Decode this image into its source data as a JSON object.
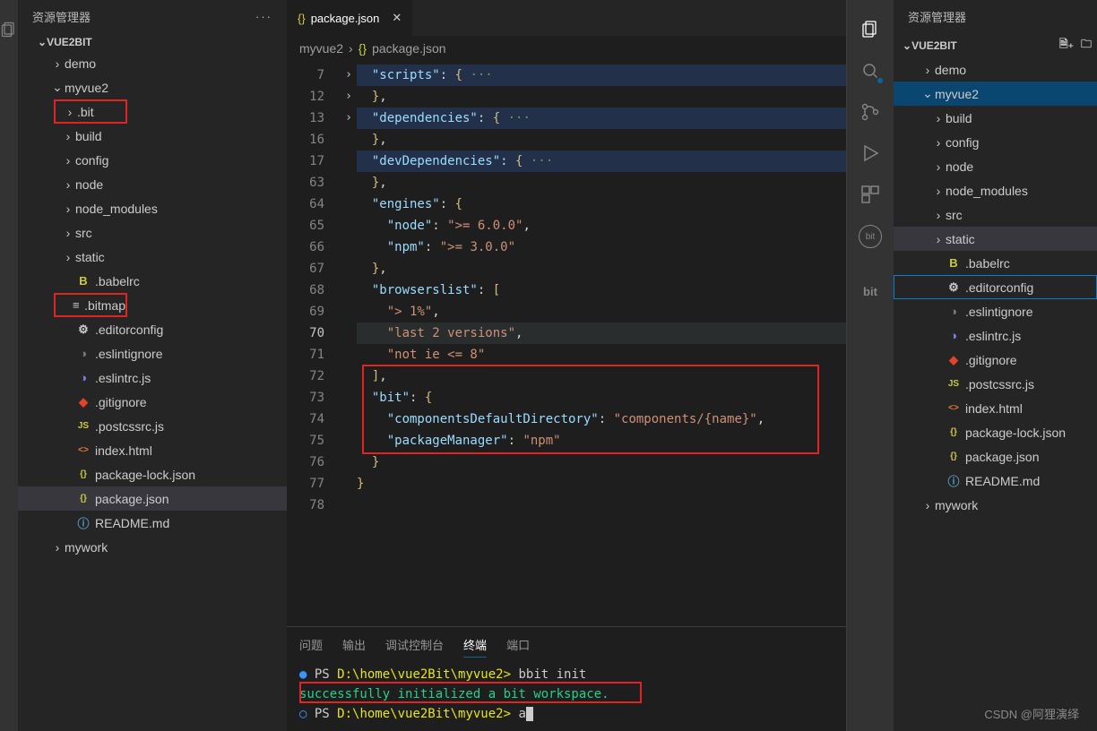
{
  "left": {
    "panel_title": "资源管理器",
    "root": "VUE2BIT",
    "items": [
      {
        "label": "demo",
        "chev": "›",
        "icon": "",
        "indent": 0
      },
      {
        "label": "myvue2",
        "chev": "⌄",
        "icon": "",
        "indent": 0
      },
      {
        "label": ".bit",
        "chev": "›",
        "icon": "",
        "indent": 1,
        "red": true
      },
      {
        "label": "build",
        "chev": "›",
        "icon": "",
        "indent": 1
      },
      {
        "label": "config",
        "chev": "›",
        "icon": "",
        "indent": 1
      },
      {
        "label": "node",
        "chev": "›",
        "icon": "",
        "indent": 1
      },
      {
        "label": "node_modules",
        "chev": "›",
        "icon": "",
        "indent": 1
      },
      {
        "label": "src",
        "chev": "›",
        "icon": "",
        "indent": 1
      },
      {
        "label": "static",
        "chev": "›",
        "icon": "",
        "indent": 1
      },
      {
        "label": ".babelrc",
        "chev": "",
        "icon": "B",
        "iconColor": "#cbcb41",
        "indent": 1
      },
      {
        "label": ".bitmap",
        "chev": "",
        "icon": "≡",
        "indent": 1,
        "red": true
      },
      {
        "label": ".editorconfig",
        "chev": "",
        "icon": "⚙",
        "indent": 1
      },
      {
        "label": ".eslintignore",
        "chev": "",
        "icon": "◑",
        "iconColor": "#7a7a7a",
        "indent": 1
      },
      {
        "label": ".eslintrc.js",
        "chev": "",
        "icon": "◑",
        "iconColor": "#8080f2",
        "indent": 1
      },
      {
        "label": ".gitignore",
        "chev": "",
        "icon": "◆",
        "iconColor": "#e24329",
        "indent": 1
      },
      {
        "label": ".postcssrc.js",
        "chev": "",
        "icon": "JS",
        "iconColor": "#cbcb41",
        "indent": 1
      },
      {
        "label": "index.html",
        "chev": "",
        "icon": "<>",
        "iconColor": "#e37933",
        "indent": 1
      },
      {
        "label": "package-lock.json",
        "chev": "",
        "icon": "{}",
        "iconColor": "#cbcb41",
        "indent": 1
      },
      {
        "label": "package.json",
        "chev": "",
        "icon": "{}",
        "iconColor": "#cbcb41",
        "indent": 1,
        "selected": true
      },
      {
        "label": "README.md",
        "chev": "",
        "icon": "ⓘ",
        "iconColor": "#519aba",
        "indent": 1
      },
      {
        "label": "mywork",
        "chev": "›",
        "icon": "",
        "indent": 0
      }
    ]
  },
  "editor": {
    "tab_label": "package.json",
    "breadcrumb1": "myvue2",
    "breadcrumb2": "package.json",
    "line_numbers": [
      "7",
      "12",
      "13",
      "16",
      "17",
      "63",
      "64",
      "65",
      "66",
      "67",
      "68",
      "69",
      "70",
      "71",
      "72",
      "73",
      "74",
      "75",
      "76",
      "77",
      "78"
    ],
    "fold": [
      "›",
      "",
      "›",
      "",
      "›",
      "",
      "",
      "",
      "",
      "",
      "",
      "",
      "",
      "",
      "",
      "",
      "",
      "",
      "",
      "",
      ""
    ],
    "code": {
      "l0": "\"scripts\"",
      "l0b": ": ",
      "l0c": "{",
      "l0d": " ···",
      "l1": "}",
      "l1b": ",",
      "l2": "\"dependencies\"",
      "l2b": ": ",
      "l2c": "{",
      "l2d": " ···",
      "l3": "}",
      "l3b": ",",
      "l4": "\"devDependencies\"",
      "l4b": ": ",
      "l4c": "{",
      "l4d": " ···",
      "l5": "}",
      "l5b": ",",
      "l6": "\"engines\"",
      "l6b": ": ",
      "l6c": "{",
      "l7a": "\"node\"",
      "l7b": ": ",
      "l7c": "\">= 6.0.0\"",
      "l7d": ",",
      "l8a": "\"npm\"",
      "l8b": ": ",
      "l8c": "\">= 3.0.0\"",
      "l9": "}",
      "l9b": ",",
      "l10": "\"browserslist\"",
      "l10b": ": ",
      "l10c": "[",
      "l11": "\"> 1%\"",
      "l11b": ",",
      "l12": "\"last 2 versions\"",
      "l12b": ",",
      "l13": "\"not ie <= 8\"",
      "l14": "]",
      "l14b": ",",
      "l15": "\"bit\"",
      "l15b": ": ",
      "l15c": "{",
      "l16a": "\"componentsDefaultDirectory\"",
      "l16b": ": ",
      "l16c": "\"components/{name}\"",
      "l16d": ",",
      "l17a": "\"packageManager\"",
      "l17b": ": ",
      "l17c": "\"npm\"",
      "l18": "}",
      "l19": "}",
      "l20": ""
    }
  },
  "panel": {
    "tabs": [
      "问题",
      "输出",
      "调试控制台",
      "终端",
      "端口"
    ],
    "line1_prefix": "PS ",
    "line1_path": "D:\\home\\vue2Bit\\myvue2>",
    "line1_cmd": " bbit init",
    "line2": "successfully initialized a bit workspace.",
    "line3_prefix": "PS ",
    "line3_path": "D:\\home\\vue2Bit\\myvue2>",
    "line3_cursor": " a"
  },
  "right": {
    "panel_title": "资源管理器",
    "root": "VUE2BIT",
    "bit_label": "bit",
    "items": [
      {
        "label": "demo",
        "chev": "›",
        "indent": 0
      },
      {
        "label": "myvue2",
        "chev": "⌄",
        "indent": 0,
        "blue": true
      },
      {
        "label": "build",
        "chev": "›",
        "indent": 1
      },
      {
        "label": "config",
        "chev": "›",
        "indent": 1
      },
      {
        "label": "node",
        "chev": "›",
        "indent": 1
      },
      {
        "label": "node_modules",
        "chev": "›",
        "indent": 1
      },
      {
        "label": "src",
        "chev": "›",
        "indent": 1
      },
      {
        "label": "static",
        "chev": "›",
        "indent": 1,
        "sel": true
      },
      {
        "label": ".babelrc",
        "chev": "",
        "icon": "B",
        "iconColor": "#cbcb41",
        "indent": 1
      },
      {
        "label": ".editorconfig",
        "chev": "",
        "icon": "⚙",
        "indent": 1,
        "out": true
      },
      {
        "label": ".eslintignore",
        "chev": "",
        "icon": "◑",
        "iconColor": "#7a7a7a",
        "indent": 1
      },
      {
        "label": ".eslintrc.js",
        "chev": "",
        "icon": "◑",
        "iconColor": "#8080f2",
        "indent": 1
      },
      {
        "label": ".gitignore",
        "chev": "",
        "icon": "◆",
        "iconColor": "#e24329",
        "indent": 1
      },
      {
        "label": ".postcssrc.js",
        "chev": "",
        "icon": "JS",
        "iconColor": "#cbcb41",
        "indent": 1
      },
      {
        "label": "index.html",
        "chev": "",
        "icon": "<>",
        "iconColor": "#e37933",
        "indent": 1
      },
      {
        "label": "package-lock.json",
        "chev": "",
        "icon": "{}",
        "iconColor": "#cbcb41",
        "indent": 1
      },
      {
        "label": "package.json",
        "chev": "",
        "icon": "{}",
        "iconColor": "#cbcb41",
        "indent": 1
      },
      {
        "label": "README.md",
        "chev": "",
        "icon": "ⓘ",
        "iconColor": "#519aba",
        "indent": 1
      },
      {
        "label": "mywork",
        "chev": "›",
        "indent": 0
      }
    ]
  },
  "watermark": "CSDN @阿狸演绎"
}
